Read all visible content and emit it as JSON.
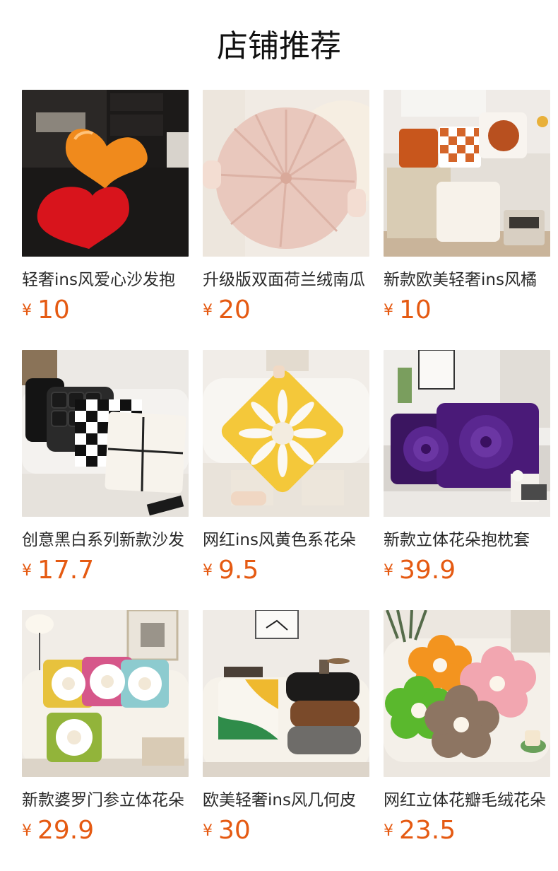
{
  "section": {
    "title": "店铺推荐"
  },
  "currency_symbol": "¥",
  "colors": {
    "price": "#e55a12"
  },
  "products": [
    {
      "name": "轻奢ins风爱心沙发抱",
      "price": "10"
    },
    {
      "name": "升级版双面荷兰绒南瓜",
      "price": "20"
    },
    {
      "name": "新款欧美轻奢ins风橘",
      "price": "10"
    },
    {
      "name": "创意黑白系列新款沙发",
      "price": "17.7"
    },
    {
      "name": "网红ins风黄色系花朵",
      "price": "9.5"
    },
    {
      "name": "新款立体花朵抱枕套",
      "price": "39.9"
    },
    {
      "name": "新款婆罗门参立体花朵",
      "price": "29.9"
    },
    {
      "name": "欧美轻奢ins风几何皮",
      "price": "30"
    },
    {
      "name": "网红立体花瓣毛绒花朵",
      "price": "23.5"
    }
  ]
}
